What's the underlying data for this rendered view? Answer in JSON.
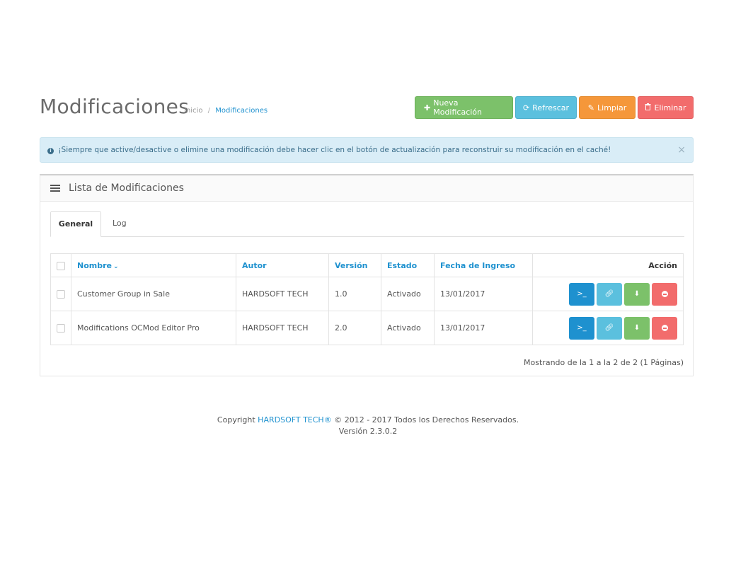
{
  "header": {
    "title": "Modificaciones",
    "breadcrumb": {
      "home": "Inicio",
      "separator": "/",
      "current": "Modificaciones"
    }
  },
  "toolbar": {
    "new_label": "Nueva Modificación",
    "refresh_label": "Refrescar",
    "clear_label": "Limpiar",
    "delete_label": "Eliminar"
  },
  "alert": {
    "text": "¡Siempre que active/desactive o elimine una modificación debe hacer clic en el botón de actualización para reconstruir su modificación en el caché!",
    "close": "×"
  },
  "panel": {
    "title": "Lista de Modificaciones",
    "tabs": [
      {
        "label": "General"
      },
      {
        "label": "Log"
      }
    ]
  },
  "table": {
    "headers": {
      "name": "Nombre",
      "author": "Autor",
      "version": "Versión",
      "status": "Estado",
      "date": "Fecha de Ingreso",
      "action": "Acción"
    },
    "rows": [
      {
        "name": "Customer Group in Sale",
        "author": "HARDSOFT TECH",
        "version": "1.0",
        "status": "Activado",
        "date": "13/01/2017"
      },
      {
        "name": "Modifications OCMod Editor Pro",
        "author": "HARDSOFT TECH",
        "version": "2.0",
        "status": "Activado",
        "date": "13/01/2017"
      }
    ],
    "paging": "Mostrando de la 1 a la 2 de 2 (1 Páginas)"
  },
  "footer": {
    "copyright_prefix": "Copyright",
    "brand": "HARDSOFT TECH®",
    "copyright_suffix": "© 2012 - 2017 Todos los Derechos Reservados.",
    "version": "Versión 2.3.0.2"
  },
  "colors": {
    "primary": "#1e91cf",
    "success": "#7cc16a",
    "info": "#5bc0de",
    "warning": "#f5973a",
    "danger": "#f26c6c",
    "alert_bg": "#d9edf7"
  },
  "icons": {
    "new": "plus-icon",
    "refresh": "refresh-icon",
    "clear": "eraser-icon",
    "delete": "trash-icon",
    "list": "list-icon",
    "edit": "terminal-icon",
    "link": "link-icon",
    "download": "download-icon",
    "remove": "minus-circle-icon"
  }
}
